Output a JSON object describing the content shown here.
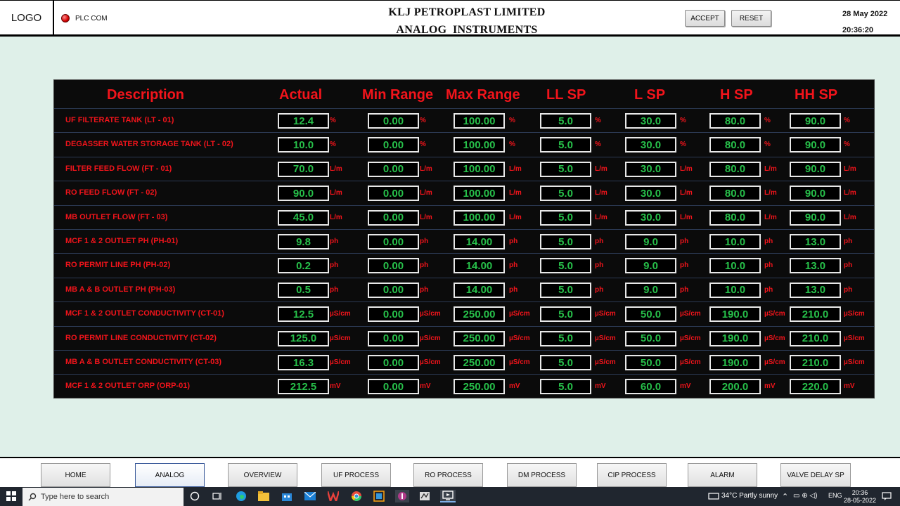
{
  "header": {
    "logo": "LOGO",
    "plc_label": "PLC COM",
    "title_line1": "KLJ PETROPLAST LIMITED",
    "title_line2": "ANALOG  INSTRUMENTS",
    "accept_label": "ACCEPT",
    "reset_label": "RESET",
    "date": "28 May 2022",
    "time": "20:36:20"
  },
  "table": {
    "columns": [
      "Description",
      "Actual",
      "Min Range",
      "Max Range",
      "LL SP",
      "L SP",
      "H SP",
      "HH SP"
    ],
    "rows": [
      {
        "desc": "UF FILTERATE TANK (LT - 01)",
        "unit": "%",
        "values": [
          "12.4",
          "0.00",
          "100.00",
          "5.0",
          "30.0",
          "80.0",
          "90.0"
        ]
      },
      {
        "desc": "DEGASSER WATER STORAGE TANK (LT - 02)",
        "unit": "%",
        "values": [
          "10.0",
          "0.00",
          "100.00",
          "5.0",
          "30.0",
          "80.0",
          "90.0"
        ]
      },
      {
        "desc": "FILTER FEED FLOW (FT - 01)",
        "unit": "L/m",
        "values": [
          "70.0",
          "0.00",
          "100.00",
          "5.0",
          "30.0",
          "80.0",
          "90.0"
        ]
      },
      {
        "desc": "RO FEED FLOW (FT - 02)",
        "unit": "L/m",
        "values": [
          "90.0",
          "0.00",
          "100.00",
          "5.0",
          "30.0",
          "80.0",
          "90.0"
        ]
      },
      {
        "desc": "MB OUTLET FLOW (FT - 03)",
        "unit": "L/m",
        "values": [
          "45.0",
          "0.00",
          "100.00",
          "5.0",
          "30.0",
          "80.0",
          "90.0"
        ]
      },
      {
        "desc": "MCF 1 & 2 OUTLET PH (PH-01)",
        "unit": "ph",
        "values": [
          "9.8",
          "0.00",
          "14.00",
          "5.0",
          "9.0",
          "10.0",
          "13.0"
        ]
      },
      {
        "desc": "RO PERMIT LINE PH (PH-02)",
        "unit": "ph",
        "values": [
          "0.2",
          "0.00",
          "14.00",
          "5.0",
          "9.0",
          "10.0",
          "13.0"
        ]
      },
      {
        "desc": "MB A & B OUTLET PH (PH-03)",
        "unit": "ph",
        "values": [
          "0.5",
          "0.00",
          "14.00",
          "5.0",
          "9.0",
          "10.0",
          "13.0"
        ]
      },
      {
        "desc": "MCF 1 & 2 OUTLET CONDUCTIVITY (CT-01)",
        "unit": "µS/cm",
        "values": [
          "12.5",
          "0.00",
          "250.00",
          "5.0",
          "50.0",
          "190.0",
          "210.0"
        ]
      },
      {
        "desc": "RO PERMIT LINE CONDUCTIVITY (CT-02)",
        "unit": "µS/cm",
        "values": [
          "125.0",
          "0.00",
          "250.00",
          "5.0",
          "50.0",
          "190.0",
          "210.0"
        ]
      },
      {
        "desc": "MB A & B OUTLET CONDUCTIVITY (CT-03)",
        "unit": "µS/cm",
        "values": [
          "16.3",
          "0.00",
          "250.00",
          "5.0",
          "50.0",
          "190.0",
          "210.0"
        ]
      },
      {
        "desc": "MCF 1 & 2 OUTLET ORP (ORP-01)",
        "unit": "mV",
        "values": [
          "212.5",
          "0.00",
          "250.00",
          "5.0",
          "60.0",
          "200.0",
          "220.0"
        ]
      }
    ]
  },
  "nav": {
    "items": [
      "HOME",
      "ANALOG",
      "OVERVIEW",
      "UF PROCESS",
      "RO PROCESS",
      "DM PROCESS",
      "CIP PROCESS",
      "ALARM",
      "VALVE DELAY SP"
    ],
    "active": "ANALOG"
  },
  "taskbar": {
    "search_placeholder": "Type here to search",
    "weather": "34°C  Partly sunny",
    "lang": "ENG",
    "clock_time": "20:36",
    "clock_date": "28-05-2022"
  },
  "colors": {
    "label_red": "#f2141b",
    "value_green": "#27c04a",
    "panel_bg": "#0b0b0b",
    "page_bg": "#dff0e9"
  }
}
